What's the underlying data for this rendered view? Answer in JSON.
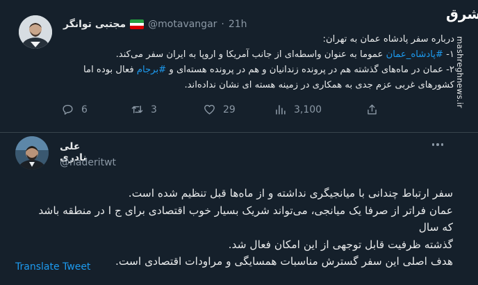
{
  "colors": {
    "background": "#15202b",
    "text": "#e7e9ea",
    "secondary": "#8b98a5",
    "link": "#1d9bf0",
    "divider": "#38444d"
  },
  "quoted_tweet": {
    "display_name": "مجتبی توانگر",
    "handle": "@motavangar",
    "separator": "·",
    "time": "21h",
    "flag_icon": "iran-flag-icon",
    "lines": [
      {
        "text": "درباره سفر پادشاه عمان به تهران:"
      },
      {
        "pre": "۱- ",
        "hashtag": "#پادشاه_عمان",
        "post": " عموما به عنوان واسطه‌ای از جانب آمریکا و اروپا به ایران سفر می‌کند."
      },
      {
        "pre": "۲- عمان در ماه‌های گذشته هم در پرونده زندانیان و هم در پرونده هسته‌ای و ",
        "hashtag": "#برجام",
        "post": " فعال بوده اما"
      },
      {
        "text": "کشورهای غربی عزم جدی به همکاری در زمینه هسته ای نشان نداده‌اند."
      }
    ],
    "actions": {
      "reply_count": "6",
      "retweet_count": "3",
      "like_count": "29",
      "views_count": "3,100"
    }
  },
  "watermark": {
    "logo": "مشرق",
    "url": "mashreghnews.ir"
  },
  "main_tweet": {
    "display_name": "علی نادری",
    "handle": "@naderitwt",
    "lines": [
      "سفر ارتباط چندانی با میانجیگری نداشته و از ماه‌ها قبل تنظیم شده است.",
      "عمان فراتر از صرفا یک میانجی، می‌تواند شریک بسیار خوب اقتصادی برای ج ا در منطقه باشد که سال",
      "گذشته ظرفیت قابل توجهی از این امکان فعال شد.",
      "هدف اصلی این سفر گسترش مناسبات همسایگی و مراودات اقتصادی است."
    ],
    "translate_label": "Translate Tweet"
  }
}
